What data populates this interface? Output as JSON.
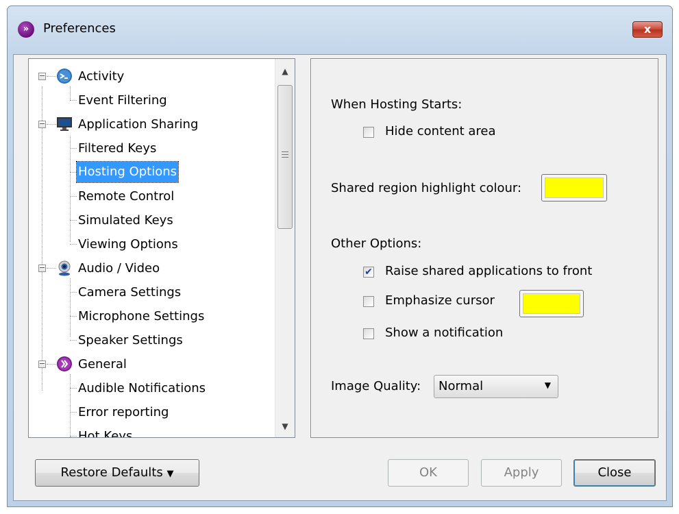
{
  "window": {
    "title": "Preferences",
    "close_label": "x"
  },
  "tree": {
    "items": [
      {
        "label": "Activity",
        "level": 0,
        "icon": "activity-icon"
      },
      {
        "label": "Event Filtering",
        "level": 1
      },
      {
        "label": "Application Sharing",
        "level": 0,
        "icon": "monitor-icon"
      },
      {
        "label": "Filtered Keys",
        "level": 1
      },
      {
        "label": "Hosting Options",
        "level": 1,
        "selected": true
      },
      {
        "label": "Remote Control",
        "level": 1
      },
      {
        "label": "Simulated Keys",
        "level": 1
      },
      {
        "label": "Viewing Options",
        "level": 1
      },
      {
        "label": "Audio / Video",
        "level": 0,
        "icon": "webcam-icon"
      },
      {
        "label": "Camera Settings",
        "level": 1
      },
      {
        "label": "Microphone Settings",
        "level": 1
      },
      {
        "label": "Speaker Settings",
        "level": 1
      },
      {
        "label": "General",
        "level": 0,
        "icon": "general-icon"
      },
      {
        "label": "Audible Notifications",
        "level": 1
      },
      {
        "label": "Error reporting",
        "level": 1
      },
      {
        "label": "Hot Keys",
        "level": 1
      }
    ]
  },
  "options": {
    "hosting_heading": "When Hosting Starts:",
    "hide_content_label": "Hide content area",
    "hide_content_checked": false,
    "highlight_label": "Shared region highlight colour:",
    "highlight_color": "#ffff00",
    "other_heading": "Other Options:",
    "raise_label": "Raise shared applications to front",
    "raise_checked": true,
    "emphasize_label": "Emphasize cursor",
    "emphasize_checked": false,
    "emphasize_color": "#ffff00",
    "notify_label": "Show a notification",
    "notify_checked": false,
    "quality_label": "Image Quality:",
    "quality_value": "Normal"
  },
  "buttons": {
    "restore": "Restore Defaults",
    "ok": "OK",
    "apply": "Apply",
    "close": "Close"
  }
}
